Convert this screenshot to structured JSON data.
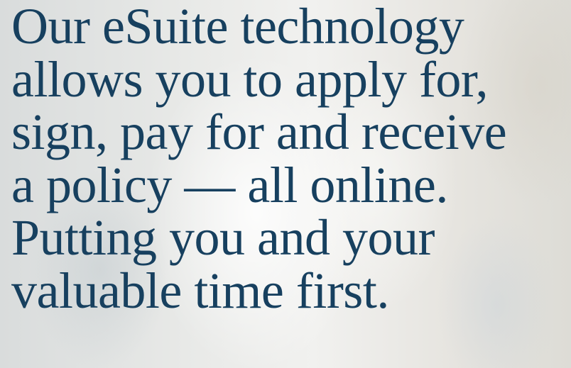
{
  "hero": {
    "text_color": "#17405f",
    "lines": [
      "Our eSuite technology",
      "allows you to apply for,",
      "sign, pay for and receive",
      "a policy — all online.",
      "Putting you and your",
      "valuable time first."
    ]
  }
}
